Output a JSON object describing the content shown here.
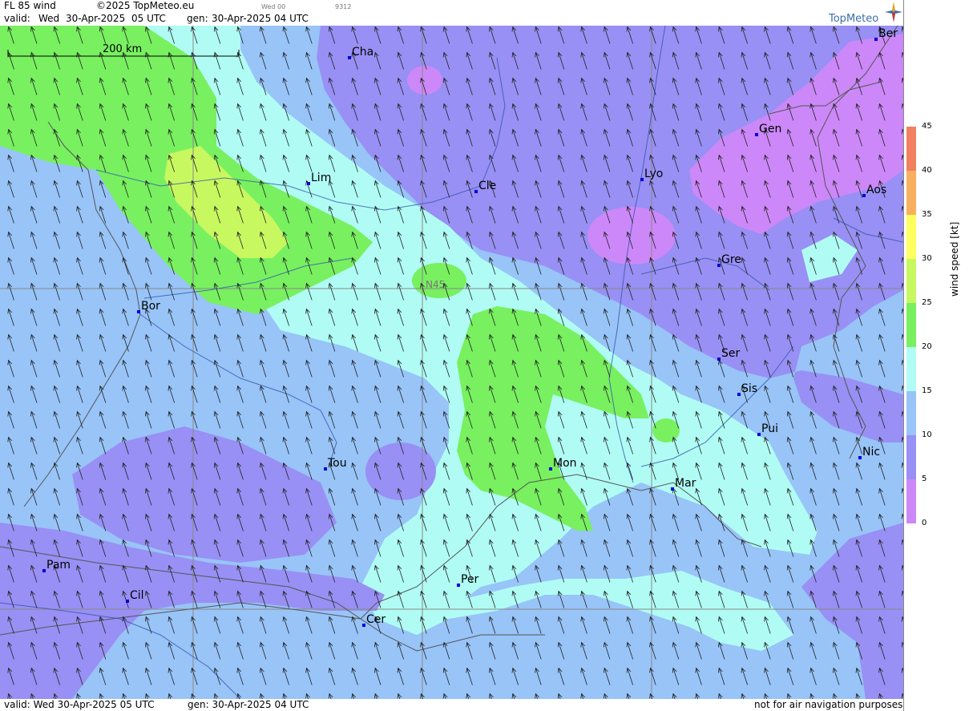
{
  "header": {
    "product": "FL 85 wind",
    "copyright": "©2025 TopMeteo.eu",
    "step_label": "Wed 00",
    "step_code": "9312",
    "valid_label": "valid:",
    "valid_day": "Wed",
    "valid_date": "30-Apr-2025",
    "valid_time": "05 UTC",
    "gen_label": "gen:",
    "gen_value": "30-Apr-2025 04 UTC",
    "brand": "TopMeteo"
  },
  "footer": {
    "valid": "valid:  Wed  30-Apr-2025  05 UTC",
    "gen": "gen: 30-Apr-2025 04 UTC",
    "disclaimer": "not for air navigation purposes"
  },
  "scale_bar": {
    "label": "200 km",
    "km": 200
  },
  "grid_label": "N45",
  "legend": {
    "title": "wind speed [kt]",
    "ticks": [
      "45",
      "40",
      "35",
      "30",
      "25",
      "20",
      "15",
      "10",
      "5",
      "0"
    ],
    "bands": [
      {
        "from": 40,
        "to": 45,
        "color": "#f08060"
      },
      {
        "from": 35,
        "to": 40,
        "color": "#f8b060"
      },
      {
        "from": 30,
        "to": 35,
        "color": "#ffff60"
      },
      {
        "from": 25,
        "to": 30,
        "color": "#c8f860"
      },
      {
        "from": 20,
        "to": 25,
        "color": "#78f060"
      },
      {
        "from": 15,
        "to": 20,
        "color": "#b0fcf4"
      },
      {
        "from": 10,
        "to": 15,
        "color": "#98c4f8"
      },
      {
        "from": 5,
        "to": 10,
        "color": "#9890f4"
      },
      {
        "from": 0,
        "to": 5,
        "color": "#cc88f8"
      }
    ]
  },
  "colors": {
    "band_0_5": "#cc88f8",
    "band_5_10": "#9890f4",
    "band_10_15": "#98c4f8",
    "band_15_20": "#b0fcf4",
    "band_20_25": "#78f060",
    "band_25_30": "#c8f860",
    "city_marker": "#0000dd",
    "border_line": "#555555",
    "river_line": "#3355aa"
  },
  "cities": [
    {
      "name": "Cha"
    },
    {
      "name": "Ber"
    },
    {
      "name": "Gen"
    },
    {
      "name": "Lim"
    },
    {
      "name": "Cle"
    },
    {
      "name": "Lyo"
    },
    {
      "name": "Aos"
    },
    {
      "name": "Gre"
    },
    {
      "name": "Bor"
    },
    {
      "name": "Ser"
    },
    {
      "name": "Sis"
    },
    {
      "name": "Pui"
    },
    {
      "name": "Tou"
    },
    {
      "name": "Mon"
    },
    {
      "name": "Mar"
    },
    {
      "name": "Nic"
    },
    {
      "name": "Pam"
    },
    {
      "name": "Per"
    },
    {
      "name": "Cil"
    },
    {
      "name": "Cer"
    }
  ],
  "wind_direction": "southerly (arrows pointing north-northwest)"
}
